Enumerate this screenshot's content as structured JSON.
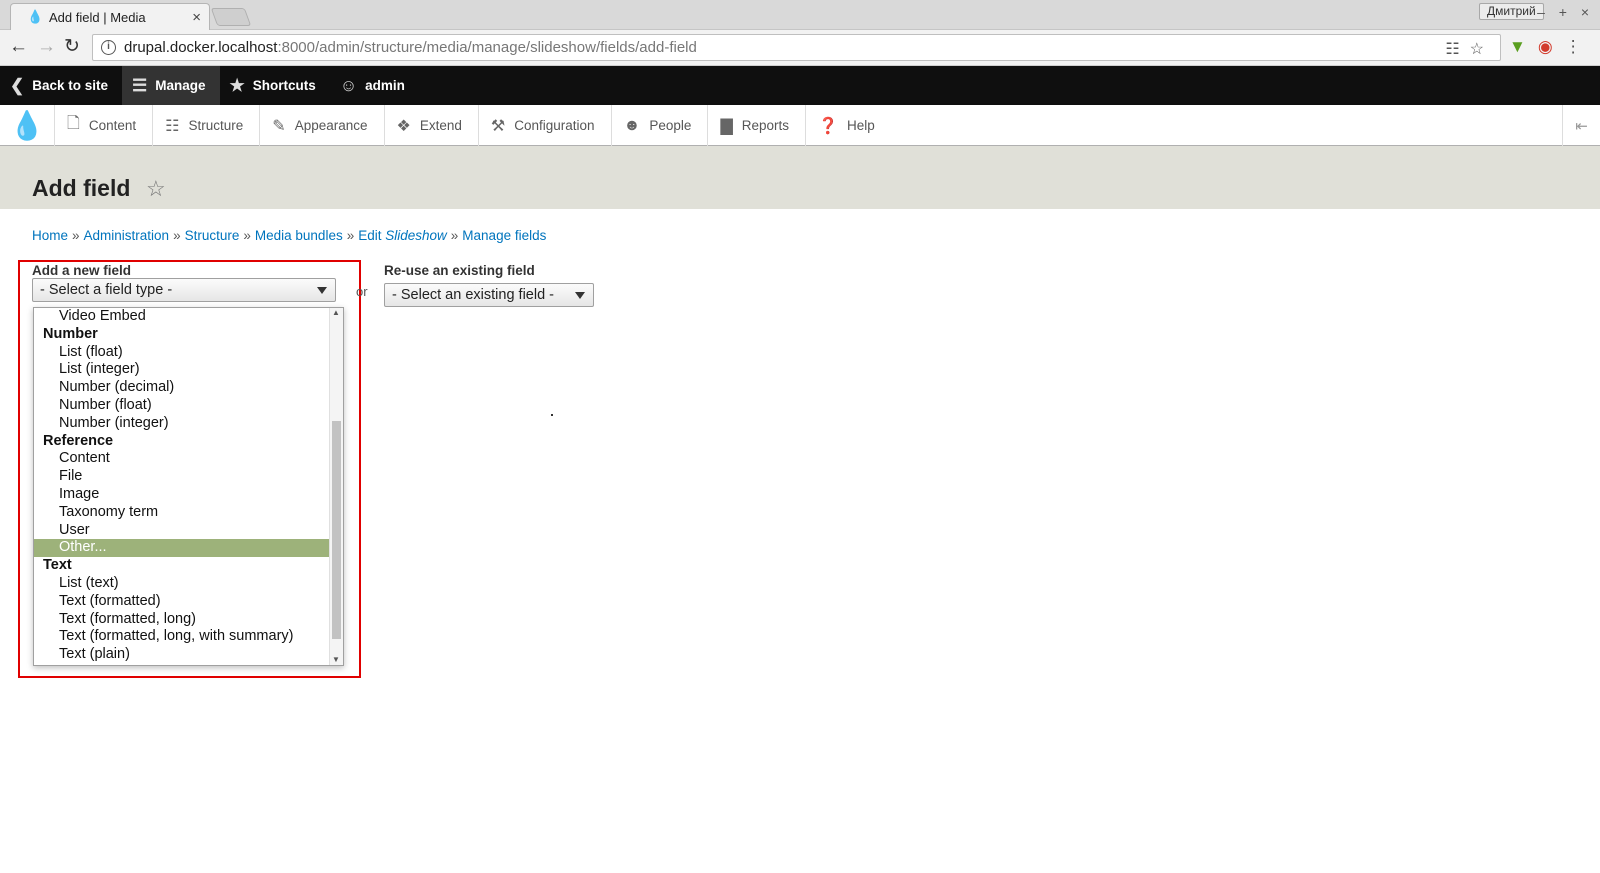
{
  "browser": {
    "tab_title": "Add field | Media",
    "tab_close": "×",
    "profile_name": "Дмитрий",
    "window_controls": "– + ×",
    "url_host": "drupal.docker.localhost",
    "url_rest": ":8000/admin/structure/media/manage/slideshow/fields/add-field"
  },
  "admin_bar": {
    "back_to_site": "Back to site",
    "manage": "Manage",
    "shortcuts": "Shortcuts",
    "user": "admin"
  },
  "tray": {
    "items": [
      {
        "label": "Content",
        "icon": "file-icon"
      },
      {
        "label": "Structure",
        "icon": "structure-icon"
      },
      {
        "label": "Appearance",
        "icon": "brush-icon"
      },
      {
        "label": "Extend",
        "icon": "puzzle-icon"
      },
      {
        "label": "Configuration",
        "icon": "wrench-icon"
      },
      {
        "label": "People",
        "icon": "people-icon"
      },
      {
        "label": "Reports",
        "icon": "bar-chart-icon"
      },
      {
        "label": "Help",
        "icon": "help-icon"
      }
    ]
  },
  "page": {
    "title": "Add field"
  },
  "breadcrumb": {
    "home": "Home",
    "administration": "Administration",
    "structure": "Structure",
    "media_bundles": "Media bundles",
    "edit_prefix": "Edit ",
    "edit_name": "Slideshow",
    "manage_fields": "Manage fields",
    "separator": "»"
  },
  "form": {
    "new_field_label": "Add a new field",
    "new_field_select": "- Select a field type -",
    "or_text": "or",
    "existing_field_label": "Re-use an existing field",
    "existing_field_select": "- Select an existing field -"
  },
  "dropdown": {
    "selected": "Other...",
    "rows": [
      {
        "label": "Video Embed",
        "group": false
      },
      {
        "label": "Number",
        "group": true
      },
      {
        "label": "List (float)",
        "group": false
      },
      {
        "label": "List (integer)",
        "group": false
      },
      {
        "label": "Number (decimal)",
        "group": false
      },
      {
        "label": "Number (float)",
        "group": false
      },
      {
        "label": "Number (integer)",
        "group": false
      },
      {
        "label": "Reference",
        "group": true
      },
      {
        "label": "Content",
        "group": false
      },
      {
        "label": "File",
        "group": false
      },
      {
        "label": "Image",
        "group": false
      },
      {
        "label": "Taxonomy term",
        "group": false
      },
      {
        "label": "User",
        "group": false
      },
      {
        "label": "Other...",
        "group": false
      },
      {
        "label": "Text",
        "group": true
      },
      {
        "label": "List (text)",
        "group": false
      },
      {
        "label": "Text (formatted)",
        "group": false
      },
      {
        "label": "Text (formatted, long)",
        "group": false
      },
      {
        "label": "Text (formatted, long, with summary)",
        "group": false
      },
      {
        "label": "Text (plain)",
        "group": false
      }
    ]
  },
  "colors": {
    "link": "#0074bd",
    "selected_option": "#9db27a",
    "highlight_border": "#e00000",
    "admin_bar": "#0f0f0f"
  }
}
